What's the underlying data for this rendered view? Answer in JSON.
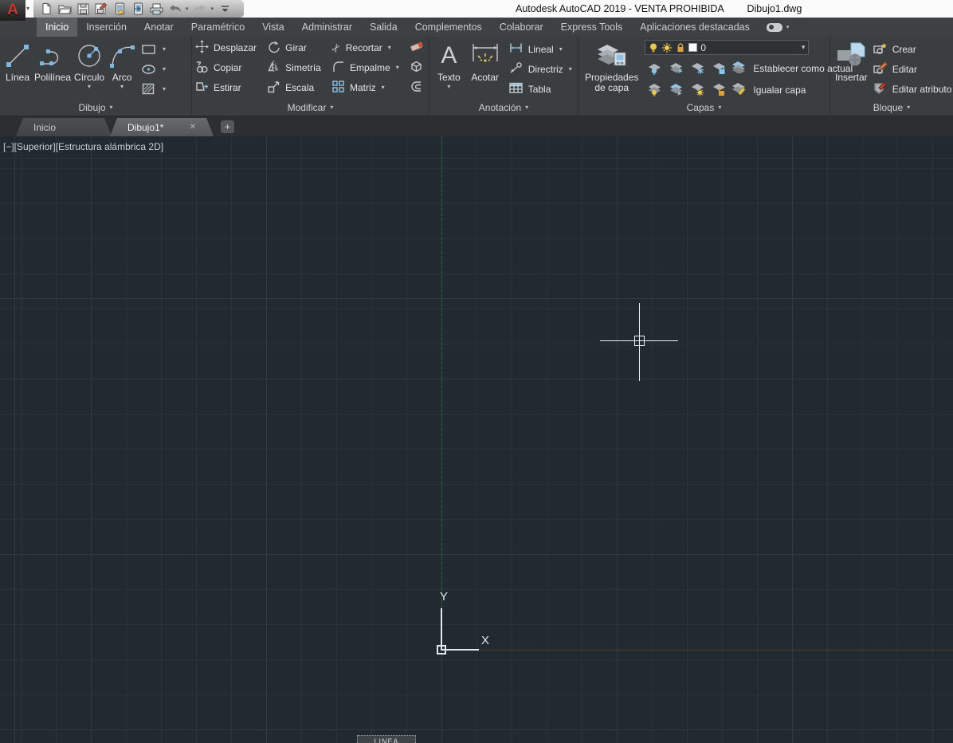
{
  "window": {
    "app_title": "Autodesk AutoCAD 2019 - VENTA PROHIBIDA",
    "doc_name": "Dibujo1.dwg"
  },
  "quick_access": {
    "icons": [
      "new",
      "open",
      "save",
      "save-as",
      "save-to-mobile",
      "open-from-mobile",
      "plot",
      "undo",
      "redo",
      "customize"
    ]
  },
  "ribbon": {
    "tabs": [
      "Inicio",
      "Inserción",
      "Anotar",
      "Paramétrico",
      "Vista",
      "Administrar",
      "Salida",
      "Complementos",
      "Colaborar",
      "Express Tools",
      "Aplicaciones destacadas"
    ],
    "panels": {
      "dibujo": {
        "title": "Dibujo",
        "buttons": {
          "linea": "Línea",
          "polilinea": "Polilínea",
          "circulo": "Círculo",
          "arco": "Arco"
        }
      },
      "modificar": {
        "title": "Modificar",
        "buttons": {
          "desplazar": "Desplazar",
          "copiar": "Copiar",
          "estirar": "Estirar",
          "girar": "Girar",
          "simetria": "Simetría",
          "escala": "Escala",
          "recortar": "Recortar",
          "empalme": "Empalme",
          "matriz": "Matriz"
        }
      },
      "anotacion": {
        "title": "Anotación",
        "buttons": {
          "texto": "Texto",
          "acotar": "Acotar",
          "lineal": "Lineal",
          "directriz": "Directriz",
          "tabla": "Tabla"
        }
      },
      "capas": {
        "title": "Capas",
        "buttons": {
          "propiedades_line1": "Propiedades",
          "propiedades_line2": "de capa",
          "establecer": "Establecer como actual",
          "igualar": "Igualar capa"
        },
        "layer_combo": {
          "value": "0"
        }
      },
      "bloque": {
        "title": "Bloque",
        "buttons": {
          "insertar": "Insertar",
          "crear": "Crear",
          "editar": "Editar",
          "editar_atributo": "Editar atributo"
        }
      }
    }
  },
  "file_tabs": {
    "home": "Inicio",
    "drawing": "Dibujo1*"
  },
  "viewport": {
    "controls_label": "[−][Superior][Estructura alámbrica 2D]",
    "ucs_x_label": "X",
    "ucs_y_label": "Y",
    "command_partial": "LINEA"
  },
  "colors": {
    "canvas_bg": "#222a31",
    "grid_minor": "#2a333b",
    "grid_major": "#303b45",
    "axis_x_red": "#573831",
    "axis_y_green": "#35543f",
    "accent_blue": "#7fb8de",
    "accent_yellow": "#e9c567",
    "ribbon_bg": "#3a3e41"
  }
}
